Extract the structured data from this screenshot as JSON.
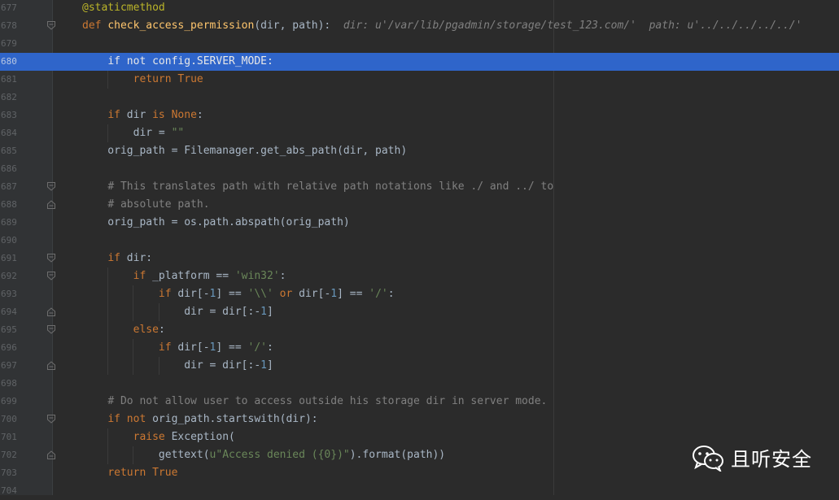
{
  "editor": {
    "lines": [
      {
        "num": "677",
        "tokens": [
          {
            "t": "@staticmethod",
            "c": "deco"
          }
        ]
      },
      {
        "num": "678",
        "fold": "open",
        "tokens": [
          {
            "t": "def ",
            "c": "kw"
          },
          {
            "t": "check_access_permission",
            "c": "fn"
          },
          {
            "t": "(dir, path):  ",
            "c": ""
          },
          {
            "t": "dir: u'/var/lib/pgadmin/storage/test_123.com/'  path: u'../../../../../'",
            "c": "hint"
          }
        ]
      },
      {
        "num": "679",
        "tokens": []
      },
      {
        "num": "680",
        "highlight": true,
        "tokens": [
          {
            "t": "    ",
            "c": ""
          },
          {
            "t": "if not ",
            "c": "kw"
          },
          {
            "t": "config.SERVER_MODE:",
            "c": ""
          }
        ]
      },
      {
        "num": "681",
        "tokens": [
          {
            "t": "        ",
            "c": ""
          },
          {
            "t": "return ",
            "c": "kw"
          },
          {
            "t": "True",
            "c": "kw"
          }
        ]
      },
      {
        "num": "682",
        "tokens": []
      },
      {
        "num": "683",
        "tokens": [
          {
            "t": "    ",
            "c": ""
          },
          {
            "t": "if ",
            "c": "kw"
          },
          {
            "t": "dir ",
            "c": ""
          },
          {
            "t": "is ",
            "c": "kw"
          },
          {
            "t": "None",
            "c": "kw"
          },
          {
            "t": ":",
            "c": ""
          }
        ]
      },
      {
        "num": "684",
        "tokens": [
          {
            "t": "        dir = ",
            "c": ""
          },
          {
            "t": "\"\"",
            "c": "str"
          }
        ]
      },
      {
        "num": "685",
        "tokens": [
          {
            "t": "    orig_path = Filemanager.get_abs_path(dir, path)",
            "c": ""
          }
        ]
      },
      {
        "num": "686",
        "tokens": []
      },
      {
        "num": "687",
        "fold": "open",
        "tokens": [
          {
            "t": "    ",
            "c": ""
          },
          {
            "t": "# This translates path with relative path notations like ./ and ../ to",
            "c": "cmt"
          }
        ]
      },
      {
        "num": "688",
        "fold": "close",
        "tokens": [
          {
            "t": "    ",
            "c": ""
          },
          {
            "t": "# absolute path.",
            "c": "cmt"
          }
        ]
      },
      {
        "num": "689",
        "tokens": [
          {
            "t": "    orig_path = os.path.abspath(orig_path)",
            "c": ""
          }
        ]
      },
      {
        "num": "690",
        "tokens": []
      },
      {
        "num": "691",
        "fold": "open",
        "tokens": [
          {
            "t": "    ",
            "c": ""
          },
          {
            "t": "if ",
            "c": "kw"
          },
          {
            "t": "dir:",
            "c": ""
          }
        ]
      },
      {
        "num": "692",
        "fold": "open",
        "tokens": [
          {
            "t": "        ",
            "c": ""
          },
          {
            "t": "if ",
            "c": "kw"
          },
          {
            "t": "_platform == ",
            "c": ""
          },
          {
            "t": "'win32'",
            "c": "str"
          },
          {
            "t": ":",
            "c": ""
          }
        ]
      },
      {
        "num": "693",
        "tokens": [
          {
            "t": "            ",
            "c": ""
          },
          {
            "t": "if ",
            "c": "kw"
          },
          {
            "t": "dir[-",
            "c": ""
          },
          {
            "t": "1",
            "c": "num"
          },
          {
            "t": "] == ",
            "c": ""
          },
          {
            "t": "'\\\\'",
            "c": "str"
          },
          {
            "t": " ",
            "c": ""
          },
          {
            "t": "or ",
            "c": "kw"
          },
          {
            "t": "dir[-",
            "c": ""
          },
          {
            "t": "1",
            "c": "num"
          },
          {
            "t": "] == ",
            "c": ""
          },
          {
            "t": "'/'",
            "c": "str"
          },
          {
            "t": ":",
            "c": ""
          }
        ]
      },
      {
        "num": "694",
        "fold": "close",
        "tokens": [
          {
            "t": "                dir = dir[:-",
            "c": ""
          },
          {
            "t": "1",
            "c": "num"
          },
          {
            "t": "]",
            "c": ""
          }
        ]
      },
      {
        "num": "695",
        "fold": "open",
        "tokens": [
          {
            "t": "        ",
            "c": ""
          },
          {
            "t": "else",
            "c": "kw"
          },
          {
            "t": ":",
            "c": ""
          }
        ]
      },
      {
        "num": "696",
        "tokens": [
          {
            "t": "            ",
            "c": ""
          },
          {
            "t": "if ",
            "c": "kw"
          },
          {
            "t": "dir[-",
            "c": ""
          },
          {
            "t": "1",
            "c": "num"
          },
          {
            "t": "] == ",
            "c": ""
          },
          {
            "t": "'/'",
            "c": "str"
          },
          {
            "t": ":",
            "c": ""
          }
        ]
      },
      {
        "num": "697",
        "fold": "close",
        "tokens": [
          {
            "t": "                dir = dir[:-",
            "c": ""
          },
          {
            "t": "1",
            "c": "num"
          },
          {
            "t": "]",
            "c": ""
          }
        ]
      },
      {
        "num": "698",
        "tokens": []
      },
      {
        "num": "699",
        "tokens": [
          {
            "t": "    ",
            "c": ""
          },
          {
            "t": "# Do not allow user to access outside his storage dir in server mode.",
            "c": "cmt"
          }
        ]
      },
      {
        "num": "700",
        "fold": "open",
        "tokens": [
          {
            "t": "    ",
            "c": ""
          },
          {
            "t": "if not ",
            "c": "kw"
          },
          {
            "t": "orig_path.startswith(dir):",
            "c": ""
          }
        ]
      },
      {
        "num": "701",
        "tokens": [
          {
            "t": "        ",
            "c": ""
          },
          {
            "t": "raise ",
            "c": "kw"
          },
          {
            "t": "Exception(",
            "c": ""
          }
        ]
      },
      {
        "num": "702",
        "fold": "close",
        "tokens": [
          {
            "t": "            gettext(",
            "c": ""
          },
          {
            "t": "u\"Access denied ({0})\"",
            "c": "str"
          },
          {
            "t": ").format(path))",
            "c": ""
          }
        ]
      },
      {
        "num": "703",
        "tokens": [
          {
            "t": "    ",
            "c": ""
          },
          {
            "t": "return ",
            "c": "kw"
          },
          {
            "t": "True",
            "c": "kw"
          }
        ]
      },
      {
        "num": "704",
        "tokens": []
      }
    ]
  },
  "watermark": {
    "icon": "wechat-icon",
    "text": "且听安全"
  }
}
